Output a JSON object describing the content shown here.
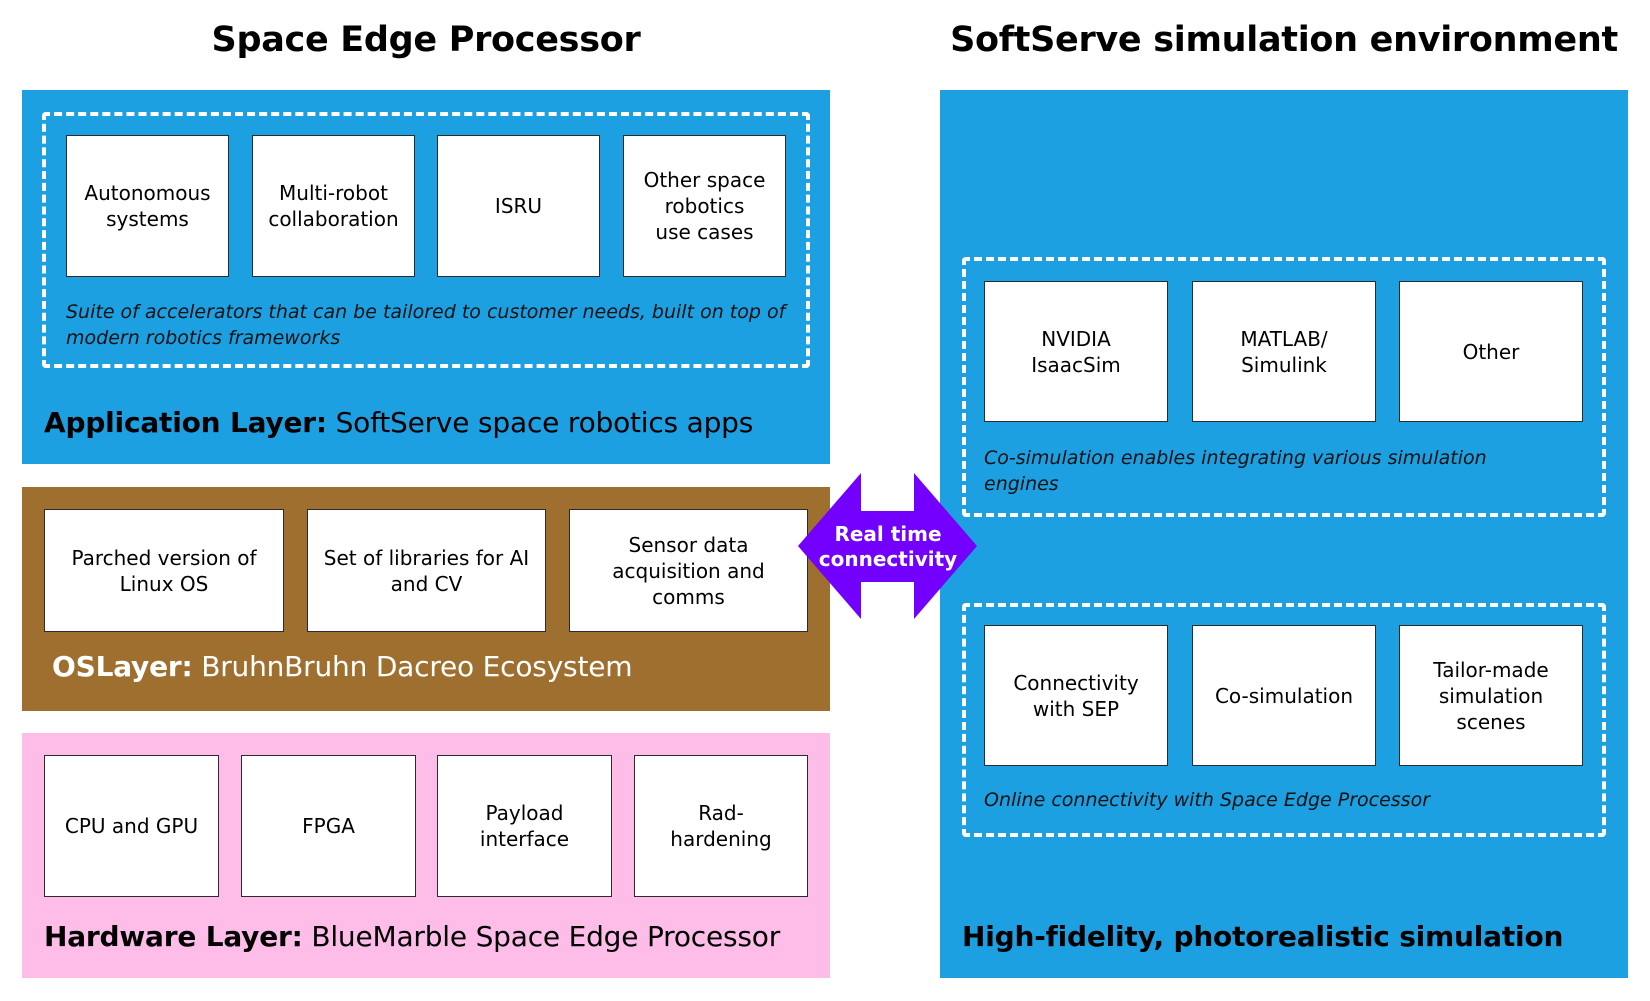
{
  "left": {
    "title": "Space Edge Processor",
    "application_layer": {
      "cards": [
        "Autonomous\nsystems",
        "Multi-robot\ncollaboration",
        "ISRU",
        "Other space\nrobotics\nuse cases"
      ],
      "note": "Suite of accelerators that can be tailored to customer needs, built on top of modern robotics frameworks",
      "label_bold": "Application Layer:",
      "label_rest": " SoftServe space robotics apps"
    },
    "os_layer": {
      "cards": [
        "Parched version of\nLinux OS",
        "Set of libraries for AI\nand CV",
        "Sensor data\nacquisition and\ncomms"
      ],
      "label_bold": "OSLayer:",
      "label_rest": " BruhnBruhn Dacreo Ecosystem"
    },
    "hardware_layer": {
      "cards": [
        "CPU and GPU",
        "FPGA",
        "Payload\ninterface",
        "Rad-\nhardening"
      ],
      "label_bold": "Hardware Layer:",
      "label_rest": " BlueMarble Space Edge Processor"
    }
  },
  "connector": {
    "label": "Real time\nconnectivity",
    "icon": "double-arrow-icon",
    "color": "#7300ff"
  },
  "right": {
    "title": "SoftServe simulation environment",
    "engines_group": {
      "cards": [
        "NVIDIA\nIsaacSim",
        "MATLAB/\nSimulink",
        "Other"
      ],
      "note": "Co-simulation enables integrating various simulation engines"
    },
    "features_group": {
      "cards": [
        "Connectivity\nwith SEP",
        "Co-simulation",
        "Tailor-made\nsimulation\nscenes"
      ],
      "note": "Online connectivity with Space Edge Processor"
    },
    "label": "High-fidelity, photorealistic simulation"
  },
  "colors": {
    "application_layer": "#1ca0e1",
    "os_layer": "#9f6f30",
    "hardware_layer": "#fdbde8",
    "simulation_panel": "#1ca0e1"
  }
}
